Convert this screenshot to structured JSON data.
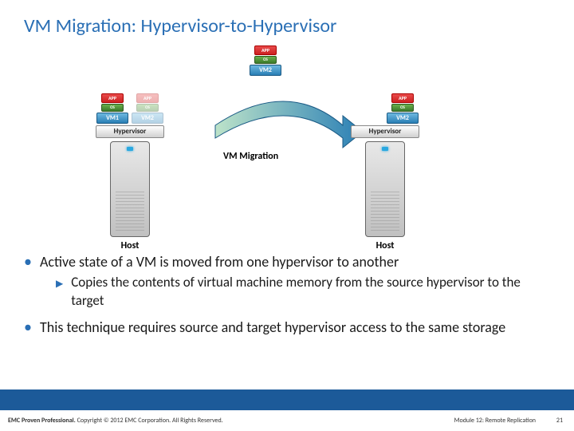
{
  "title": "VM Migration: Hypervisor-to-Hypervisor",
  "diagram": {
    "app_label": "APP",
    "os_label": "OS",
    "vm1_label": "VM1",
    "vm2_label": "VM2",
    "hypervisor_label": "Hypervisor",
    "host_label": "Host",
    "migration_label": "VM Migration"
  },
  "bullets": {
    "b1": "Active state of a VM is moved from one hypervisor to another",
    "b1_sub": "Copies the contents of virtual machine memory from the source hypervisor to the target",
    "b2": "This technique requires source and target hypervisor access to the same storage"
  },
  "footer": {
    "brand": "EMC Proven Professional.",
    "copyright": "Copyright © 2012 EMC Corporation. All Rights Reserved.",
    "module": "Module 12: Remote Replication",
    "page": "21"
  }
}
